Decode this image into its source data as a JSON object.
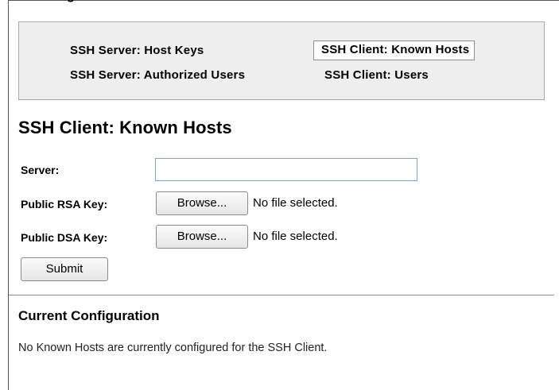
{
  "header": {
    "partial_heading": "g"
  },
  "nav": {
    "host_keys": "SSH Server: Host Keys",
    "authorized_users": "SSH Server: Authorized Users",
    "known_hosts": "SSH Client: Known Hosts",
    "client_users": "SSH Client: Users",
    "active_item": "SSH Client: Known Hosts"
  },
  "page": {
    "title": "SSH Client: Known Hosts"
  },
  "form": {
    "server_label": "Server:",
    "server_value": "",
    "server_placeholder": "",
    "rsa_label": "Public RSA Key:",
    "dsa_label": "Public DSA Key:",
    "browse_label": "Browse...",
    "rsa_file_status": "No file selected.",
    "dsa_file_status": "No file selected.",
    "submit_label": "Submit"
  },
  "config": {
    "title": "Current Configuration",
    "status": "No Known Hosts are currently configured for the SSH Client."
  },
  "colors": {
    "nav_background": "#eeeeee",
    "input_border": "#7aa7c7"
  }
}
